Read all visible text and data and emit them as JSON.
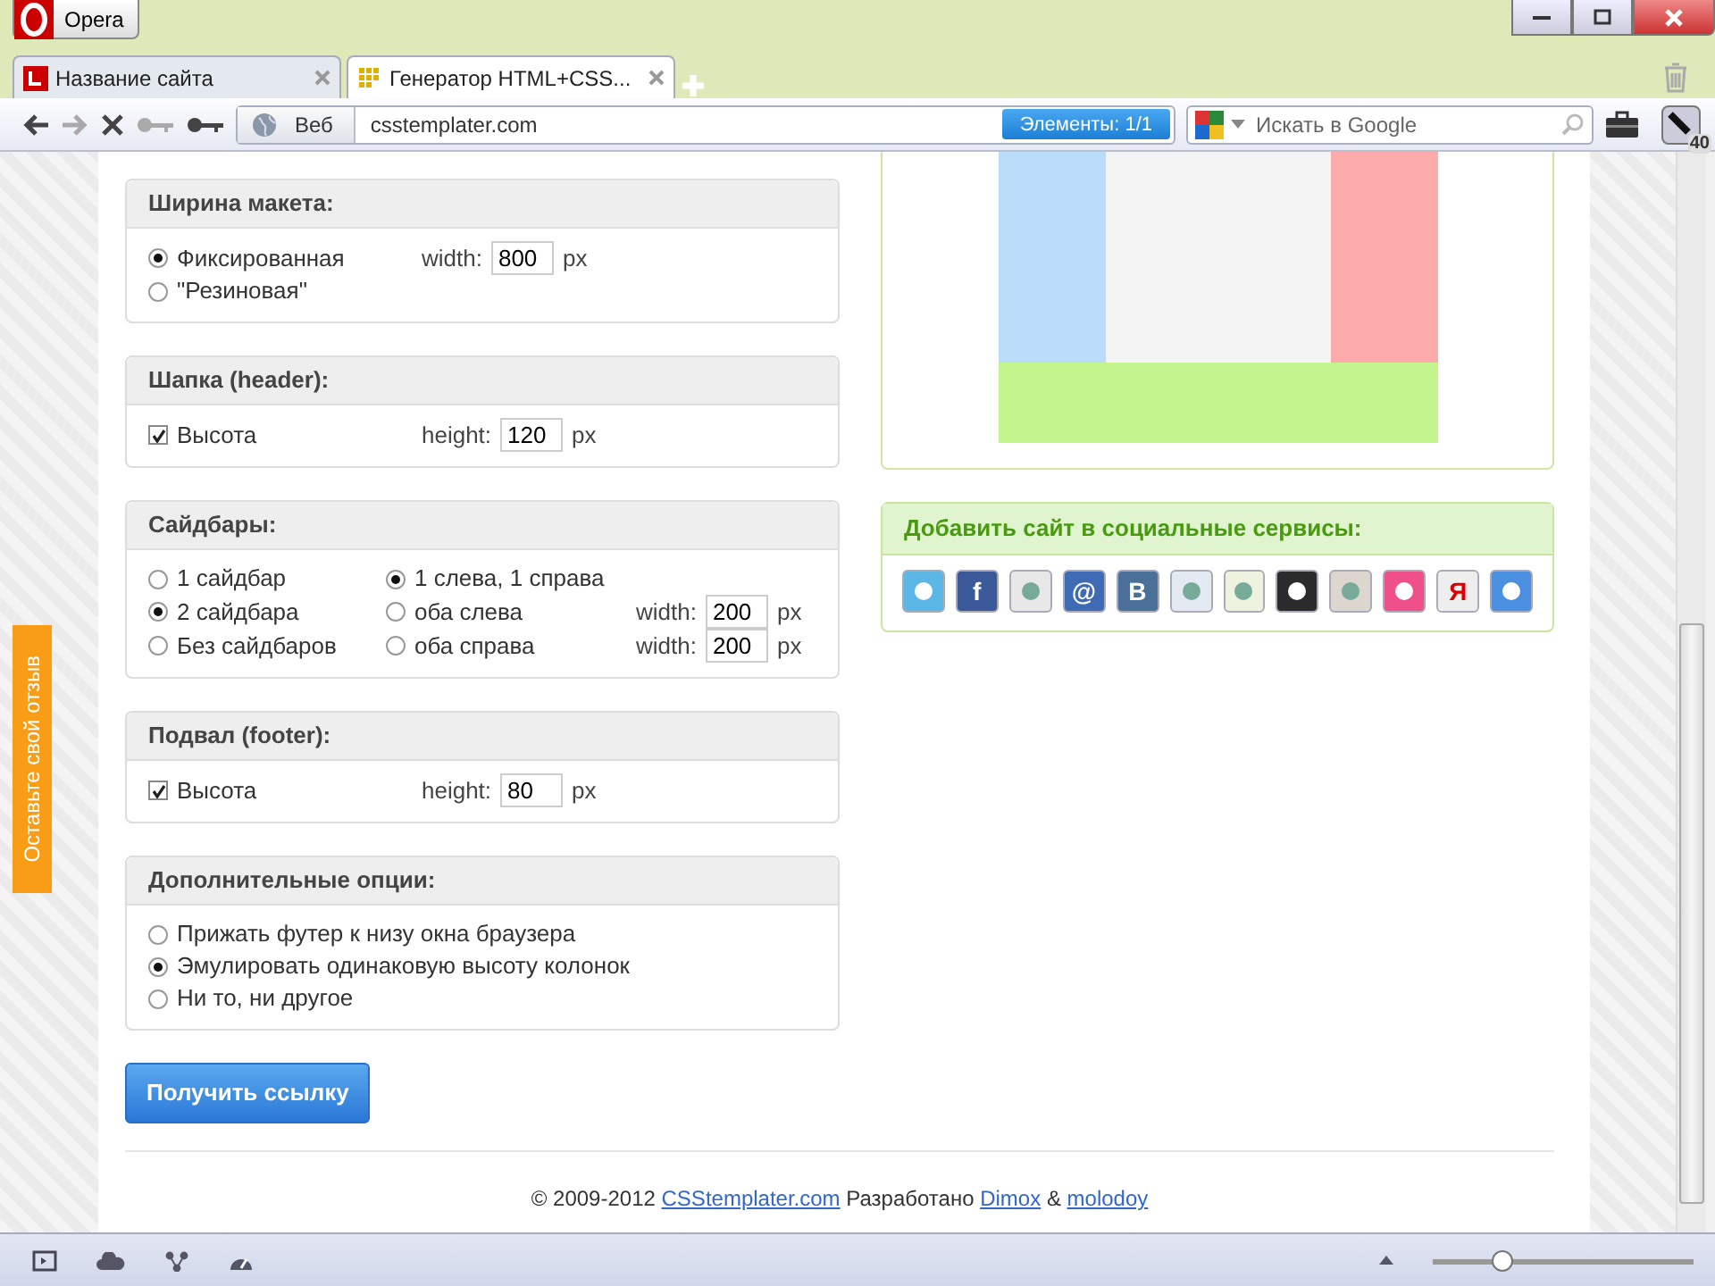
{
  "browser": {
    "app_button": "Opera",
    "tabs": [
      {
        "title": "Название сайта",
        "selected": false
      },
      {
        "title": "Генератор HTML+CSS...",
        "selected": true
      }
    ],
    "toolbar": {
      "web_label": "Веб",
      "address": "csstemplater.com",
      "find_label": "Элементы:",
      "find_count": "1/1",
      "search_placeholder": "Искать в Google",
      "tabs_badge": "40"
    },
    "status_bar": {
      "zoom": {
        "level": 0.27
      }
    }
  },
  "feedback_tab": "Оставьте свой отзыв",
  "sections": [
    {
      "title": "Ширина макета:",
      "rows": [
        [
          {
            "kind": "radio",
            "label": "Фиксированная",
            "selected": true
          },
          {
            "kind": "field",
            "label": "width:",
            "value": "800",
            "unit": "px"
          }
        ],
        [
          {
            "kind": "radio",
            "label": "\"Резиновая\"",
            "selected": false
          }
        ]
      ]
    },
    {
      "title": "Шапка (header):",
      "rows": [
        [
          {
            "kind": "checkbox",
            "label": "Высота",
            "checked": true
          },
          {
            "kind": "field",
            "label": "height:",
            "value": "120",
            "unit": "px"
          }
        ]
      ]
    },
    {
      "title": "Сайдбары:",
      "rows": [
        [
          {
            "kind": "radio",
            "label": "1 сайдбар",
            "selected": false
          },
          {
            "kind": "radio",
            "label": "1 слева, 1 справа",
            "selected": true
          }
        ],
        [
          {
            "kind": "radio",
            "label": "2 сайдбара",
            "selected": true
          },
          {
            "kind": "radio",
            "label": "оба слева",
            "selected": false
          },
          {
            "kind": "field",
            "label": "width:",
            "value": "200",
            "unit": "px"
          }
        ],
        [
          {
            "kind": "radio",
            "label": "Без сайдбаров",
            "selected": false
          },
          {
            "kind": "radio",
            "label": "оба справа",
            "selected": false
          },
          {
            "kind": "field",
            "label": "width:",
            "value": "200",
            "unit": "px"
          }
        ]
      ]
    },
    {
      "title": "Подвал (footer):",
      "rows": [
        [
          {
            "kind": "checkbox",
            "label": "Высота",
            "checked": true
          },
          {
            "kind": "field",
            "label": "height:",
            "value": "80",
            "unit": "px"
          }
        ]
      ]
    },
    {
      "title": "Дополнительные опции:",
      "rows": [
        [
          {
            "kind": "radio",
            "label": "Прижать футер к низу окна браузера",
            "selected": false
          }
        ],
        [
          {
            "kind": "radio",
            "label": "Эмулировать одинаковую высоту колонок",
            "selected": true
          }
        ],
        [
          {
            "kind": "radio",
            "label": "Ни то, ни другое",
            "selected": false
          }
        ]
      ]
    }
  ],
  "submit_button": "Получить ссылку",
  "social": {
    "title": "Добавить сайт в социальные сервисы:",
    "services": [
      {
        "color": "#5bb8e6"
      },
      {
        "color": "#3b5998",
        "glyph": "f"
      },
      {
        "color": "#e8e8e8"
      },
      {
        "color": "#3f6bb5",
        "glyph": "@"
      },
      {
        "color": "#4a6f98",
        "glyph": "B"
      },
      {
        "color": "#e4eaf2"
      },
      {
        "color": "#eef3e0"
      },
      {
        "color": "#2b2b2b"
      },
      {
        "color": "#dcd6cf"
      },
      {
        "color": "#f0508a"
      },
      {
        "color": "#eeeeee",
        "glyph": "Я"
      },
      {
        "color": "#4a8fe0"
      }
    ]
  },
  "footer": [
    {
      "kind": "text",
      "text": "© 2009-2012 "
    },
    {
      "kind": "link",
      "text": "CSStemplater.com"
    },
    {
      "kind": "text",
      "text": " Разработано "
    },
    {
      "kind": "link",
      "text": "Dimox"
    },
    {
      "kind": "text",
      "text": " & "
    },
    {
      "kind": "link",
      "text": "molodoy"
    }
  ]
}
